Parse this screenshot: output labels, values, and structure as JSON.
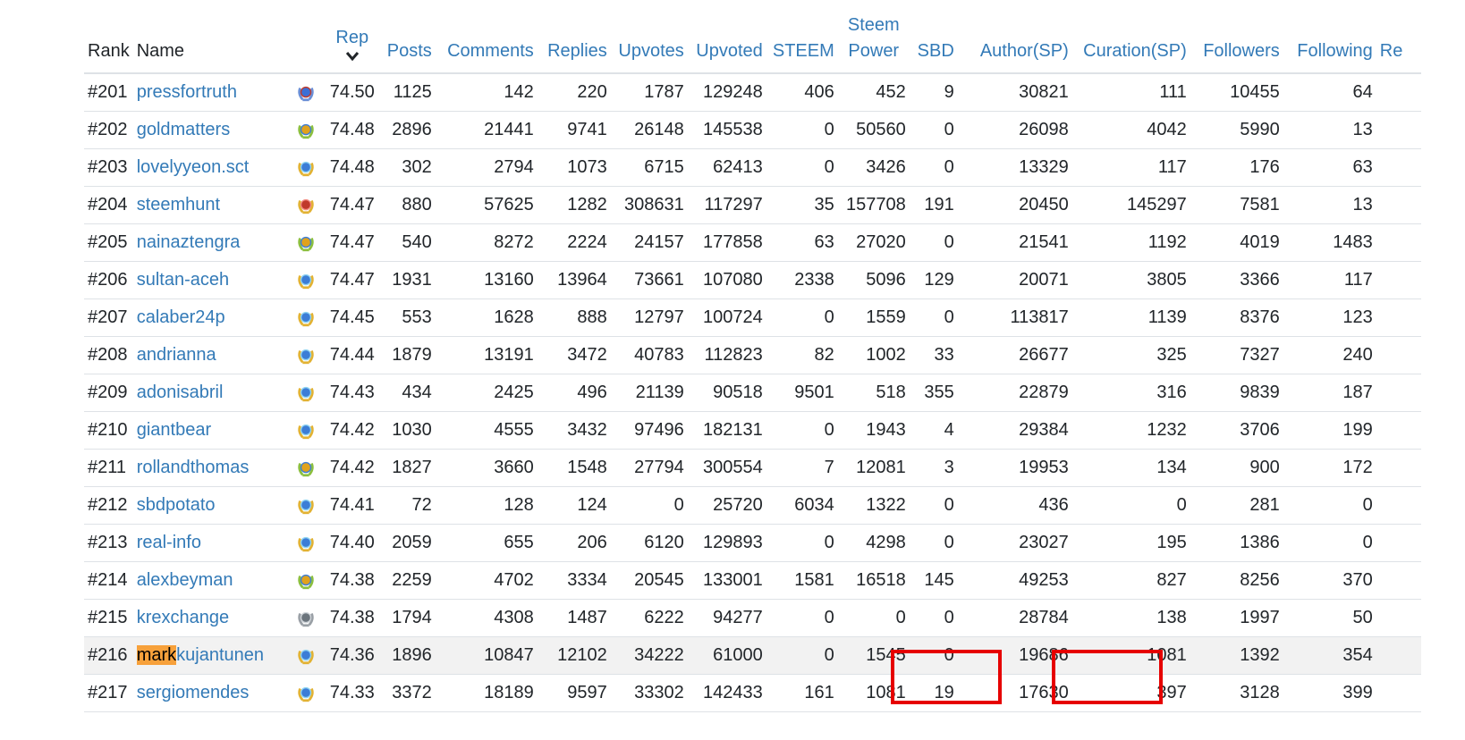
{
  "headers": {
    "rank": "Rank",
    "name": "Name",
    "rep": "Rep",
    "posts": "Posts",
    "comments": "Comments",
    "replies": "Replies",
    "upvotes": "Upvotes",
    "upvoted": "Upvoted",
    "steem": "STEEM",
    "sp_line1": "Steem",
    "sp_line2": "Power",
    "sbd": "SBD",
    "author": "Author(SP)",
    "curation": "Curation(SP)",
    "followers": "Followers",
    "following": "Following",
    "re": "Re"
  },
  "search_highlight": "mark",
  "colors": {
    "link": "#337ab7",
    "highlight": "#f7a13b",
    "annotation_box": "#e60000"
  },
  "rows": [
    {
      "rank": "#201",
      "name": "pressfortruth",
      "badge": "shield-blue",
      "rep": "74.50",
      "posts": "1125",
      "comments": "142",
      "replies": "220",
      "upvotes": "1787",
      "upvoted": "129248",
      "steem": "406",
      "sp": "452",
      "sbd": "9",
      "author": "30821",
      "curation": "111",
      "followers": "10455",
      "following": "64"
    },
    {
      "rank": "#202",
      "name": "goldmatters",
      "badge": "laurel-gold",
      "rep": "74.48",
      "posts": "2896",
      "comments": "21441",
      "replies": "9741",
      "upvotes": "26148",
      "upvoted": "145538",
      "steem": "0",
      "sp": "50560",
      "sbd": "0",
      "author": "26098",
      "curation": "4042",
      "followers": "5990",
      "following": "13"
    },
    {
      "rank": "#203",
      "name": "lovelyyeon.sct",
      "badge": "laurel-blue",
      "rep": "74.48",
      "posts": "302",
      "comments": "2794",
      "replies": "1073",
      "upvotes": "6715",
      "upvoted": "62413",
      "steem": "0",
      "sp": "3426",
      "sbd": "0",
      "author": "13329",
      "curation": "117",
      "followers": "176",
      "following": "63"
    },
    {
      "rank": "#204",
      "name": "steemhunt",
      "badge": "laurel-red",
      "rep": "74.47",
      "posts": "880",
      "comments": "57625",
      "replies": "1282",
      "upvotes": "308631",
      "upvoted": "117297",
      "steem": "35",
      "sp": "157708",
      "sbd": "191",
      "author": "20450",
      "curation": "145297",
      "followers": "7581",
      "following": "13"
    },
    {
      "rank": "#205",
      "name": "nainaztengra",
      "badge": "laurel-gold",
      "rep": "74.47",
      "posts": "540",
      "comments": "8272",
      "replies": "2224",
      "upvotes": "24157",
      "upvoted": "177858",
      "steem": "63",
      "sp": "27020",
      "sbd": "0",
      "author": "21541",
      "curation": "1192",
      "followers": "4019",
      "following": "1483"
    },
    {
      "rank": "#206",
      "name": "sultan-aceh",
      "badge": "laurel-blue",
      "rep": "74.47",
      "posts": "1931",
      "comments": "13160",
      "replies": "13964",
      "upvotes": "73661",
      "upvoted": "107080",
      "steem": "2338",
      "sp": "5096",
      "sbd": "129",
      "author": "20071",
      "curation": "3805",
      "followers": "3366",
      "following": "117"
    },
    {
      "rank": "#207",
      "name": "calaber24p",
      "badge": "laurel-blue",
      "rep": "74.45",
      "posts": "553",
      "comments": "1628",
      "replies": "888",
      "upvotes": "12797",
      "upvoted": "100724",
      "steem": "0",
      "sp": "1559",
      "sbd": "0",
      "author": "113817",
      "curation": "1139",
      "followers": "8376",
      "following": "123"
    },
    {
      "rank": "#208",
      "name": "andrianna",
      "badge": "laurel-blue",
      "rep": "74.44",
      "posts": "1879",
      "comments": "13191",
      "replies": "3472",
      "upvotes": "40783",
      "upvoted": "112823",
      "steem": "82",
      "sp": "1002",
      "sbd": "33",
      "author": "26677",
      "curation": "325",
      "followers": "7327",
      "following": "240"
    },
    {
      "rank": "#209",
      "name": "adonisabril",
      "badge": "laurel-blue",
      "rep": "74.43",
      "posts": "434",
      "comments": "2425",
      "replies": "496",
      "upvotes": "21139",
      "upvoted": "90518",
      "steem": "9501",
      "sp": "518",
      "sbd": "355",
      "author": "22879",
      "curation": "316",
      "followers": "9839",
      "following": "187"
    },
    {
      "rank": "#210",
      "name": "giantbear",
      "badge": "laurel-blue",
      "rep": "74.42",
      "posts": "1030",
      "comments": "4555",
      "replies": "3432",
      "upvotes": "97496",
      "upvoted": "182131",
      "steem": "0",
      "sp": "1943",
      "sbd": "4",
      "author": "29384",
      "curation": "1232",
      "followers": "3706",
      "following": "199"
    },
    {
      "rank": "#211",
      "name": "rollandthomas",
      "badge": "laurel-gold",
      "rep": "74.42",
      "posts": "1827",
      "comments": "3660",
      "replies": "1548",
      "upvotes": "27794",
      "upvoted": "300554",
      "steem": "7",
      "sp": "12081",
      "sbd": "3",
      "author": "19953",
      "curation": "134",
      "followers": "900",
      "following": "172"
    },
    {
      "rank": "#212",
      "name": "sbdpotato",
      "badge": "laurel-blue",
      "rep": "74.41",
      "posts": "72",
      "comments": "128",
      "replies": "124",
      "upvotes": "0",
      "upvoted": "25720",
      "steem": "6034",
      "sp": "1322",
      "sbd": "0",
      "author": "436",
      "curation": "0",
      "followers": "281",
      "following": "0"
    },
    {
      "rank": "#213",
      "name": "real-info",
      "badge": "laurel-blue",
      "rep": "74.40",
      "posts": "2059",
      "comments": "655",
      "replies": "206",
      "upvotes": "6120",
      "upvoted": "129893",
      "steem": "0",
      "sp": "4298",
      "sbd": "0",
      "author": "23027",
      "curation": "195",
      "followers": "1386",
      "following": "0"
    },
    {
      "rank": "#214",
      "name": "alexbeyman",
      "badge": "laurel-gold",
      "rep": "74.38",
      "posts": "2259",
      "comments": "4702",
      "replies": "3334",
      "upvotes": "20545",
      "upvoted": "133001",
      "steem": "1581",
      "sp": "16518",
      "sbd": "145",
      "author": "49253",
      "curation": "827",
      "followers": "8256",
      "following": "370"
    },
    {
      "rank": "#215",
      "name": "krexchange",
      "badge": "fish-grey",
      "rep": "74.38",
      "posts": "1794",
      "comments": "4308",
      "replies": "1487",
      "upvotes": "6222",
      "upvoted": "94277",
      "steem": "0",
      "sp": "0",
      "sbd": "0",
      "author": "28784",
      "curation": "138",
      "followers": "1997",
      "following": "50"
    },
    {
      "rank": "#216",
      "name": "markkujantunen",
      "badge": "laurel-blue",
      "rep": "74.36",
      "posts": "1896",
      "comments": "10847",
      "replies": "12102",
      "upvotes": "34222",
      "upvoted": "61000",
      "steem": "0",
      "sp": "1545",
      "sbd": "0",
      "author": "19686",
      "curation": "1081",
      "followers": "1392",
      "following": "354",
      "highlighted": true
    },
    {
      "rank": "#217",
      "name": "sergiomendes",
      "badge": "laurel-blue",
      "rep": "74.33",
      "posts": "3372",
      "comments": "18189",
      "replies": "9597",
      "upvotes": "33302",
      "upvoted": "142433",
      "steem": "161",
      "sp": "1081",
      "sbd": "19",
      "author": "17630",
      "curation": "397",
      "followers": "3128",
      "following": "399"
    }
  ]
}
